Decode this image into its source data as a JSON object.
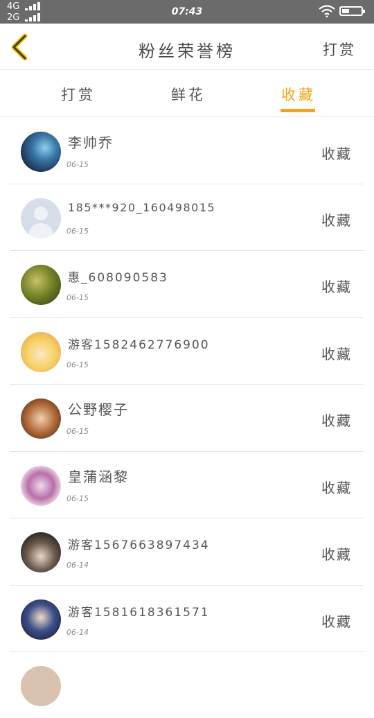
{
  "status_bar": {
    "signal_1": "4G",
    "signal_2": "2G",
    "time": "07:43"
  },
  "header": {
    "title": "粉丝荣誉榜",
    "right_button": "打赏"
  },
  "tabs": [
    {
      "label": "打赏",
      "active": false
    },
    {
      "label": "鲜花",
      "active": false
    },
    {
      "label": "收藏",
      "active": true
    }
  ],
  "colors": {
    "accent": "#f2a516",
    "status_bar": "#6b6b6b",
    "text": "#555555"
  },
  "list": [
    {
      "name": "李帅乔",
      "date": "06-15",
      "action": "收藏"
    },
    {
      "name": "185***920_160498015",
      "date": "06-15",
      "action": "收藏"
    },
    {
      "name": "惠_608090583",
      "date": "06-15",
      "action": "收藏"
    },
    {
      "name": "游客1582462776900",
      "date": "06-15",
      "action": "收藏"
    },
    {
      "name": "公野樱子",
      "date": "06-15",
      "action": "收藏"
    },
    {
      "name": "皇蒲涵黎",
      "date": "06-15",
      "action": "收藏"
    },
    {
      "name": "游客1567663897434",
      "date": "06-14",
      "action": "收藏"
    },
    {
      "name": "游客1581618361571",
      "date": "06-14",
      "action": "收藏"
    }
  ]
}
